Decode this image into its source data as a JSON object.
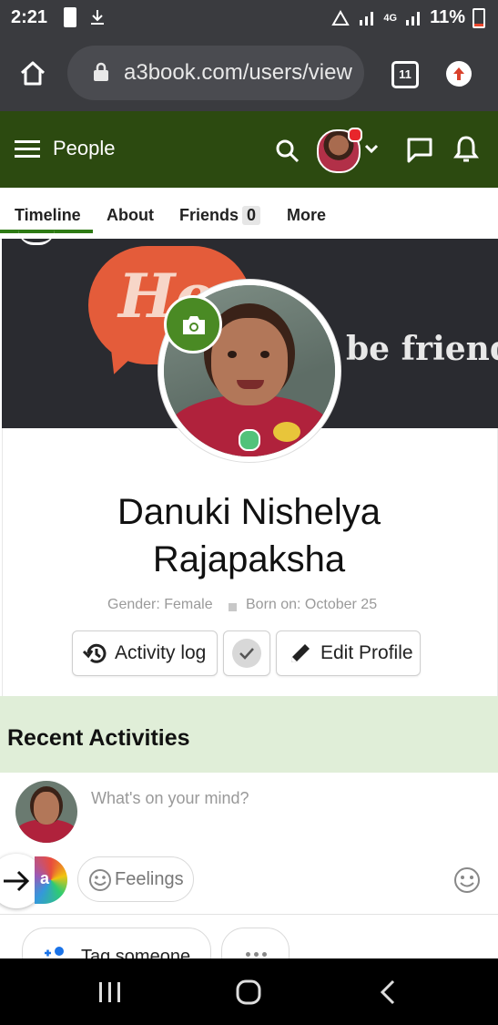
{
  "status_bar": {
    "time": "2:21",
    "battery": "11%",
    "network": "4G"
  },
  "browser": {
    "url": "a3book.com/users/view",
    "tab_count": "11"
  },
  "app_bar": {
    "title": "People"
  },
  "tabs": [
    {
      "label": "Timeline"
    },
    {
      "label": "About"
    },
    {
      "label": "Friends",
      "count": "0"
    },
    {
      "label": "More"
    }
  ],
  "cover": {
    "bubble_text": "Hey",
    "banner_text": "be friends"
  },
  "profile": {
    "name_line1": "Danuki Nishelya",
    "name_line2": "Rajapaksha",
    "gender": "Gender: Female",
    "born": "Born on: October 25",
    "online_color": "#52c27a"
  },
  "actions": {
    "activity_log": "Activity log",
    "edit_profile": "Edit Profile"
  },
  "recent": {
    "title": "Recent Activities"
  },
  "composer": {
    "placeholder": "What's on your mind?",
    "avatar_letter": "a",
    "feelings": "Feelings",
    "tag_someone": "Tag someone"
  },
  "colors": {
    "brand_green": "#2c4a10",
    "accent_green": "#2d7a14",
    "camera_green": "#4a8a24",
    "recent_bg": "#e0eed8"
  }
}
